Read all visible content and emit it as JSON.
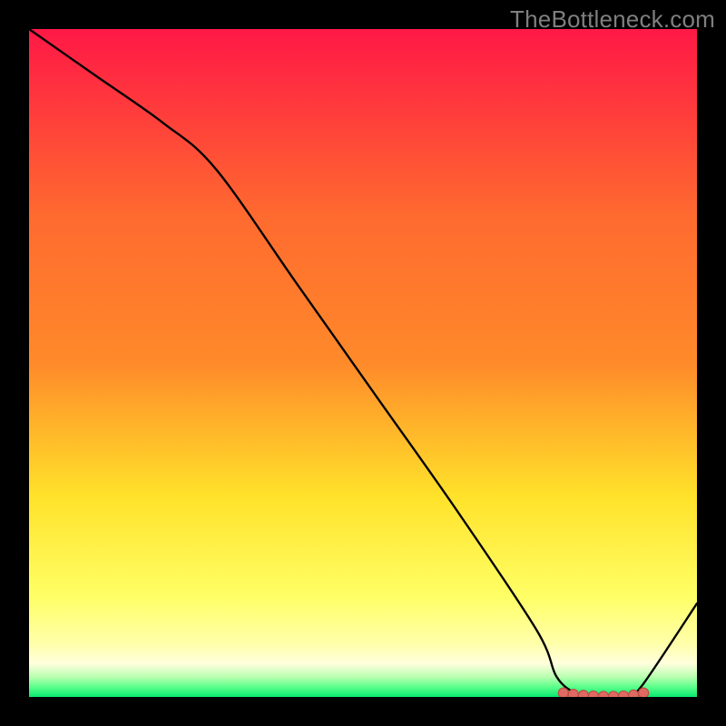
{
  "watermark": "TheBottleneck.com",
  "colors": {
    "background": "#000000",
    "grad_top": "#ff1846",
    "grad_mid_high": "#ff8a2a",
    "grad_mid": "#ffe22a",
    "grad_low": "#ffff66",
    "grad_pale": "#ffffdd",
    "grad_green1": "#b9ffb0",
    "grad_green2": "#5cff8b",
    "grad_bottom": "#07e86f",
    "line": "#000000",
    "marker_fill": "#de6a63",
    "marker_stroke": "#c24842"
  },
  "chart_data": {
    "type": "line",
    "title": "",
    "xlabel": "",
    "ylabel": "",
    "xlim": [
      0,
      100
    ],
    "ylim": [
      0,
      100
    ],
    "series": [
      {
        "name": "curve",
        "x": [
          0,
          10,
          20,
          28,
          40,
          52,
          64,
          76,
          79,
          82,
          85,
          88,
          90,
          92,
          100
        ],
        "y": [
          100,
          93,
          86,
          79,
          62,
          45,
          28,
          10,
          3,
          0.5,
          0,
          0,
          0.5,
          2,
          14
        ]
      }
    ],
    "markers": {
      "name": "dots",
      "x": [
        80,
        81.5,
        83,
        84.5,
        86,
        87.5,
        89,
        90.5,
        92
      ],
      "y": [
        0.6,
        0.4,
        0.25,
        0.15,
        0.1,
        0.1,
        0.15,
        0.3,
        0.6
      ]
    }
  }
}
